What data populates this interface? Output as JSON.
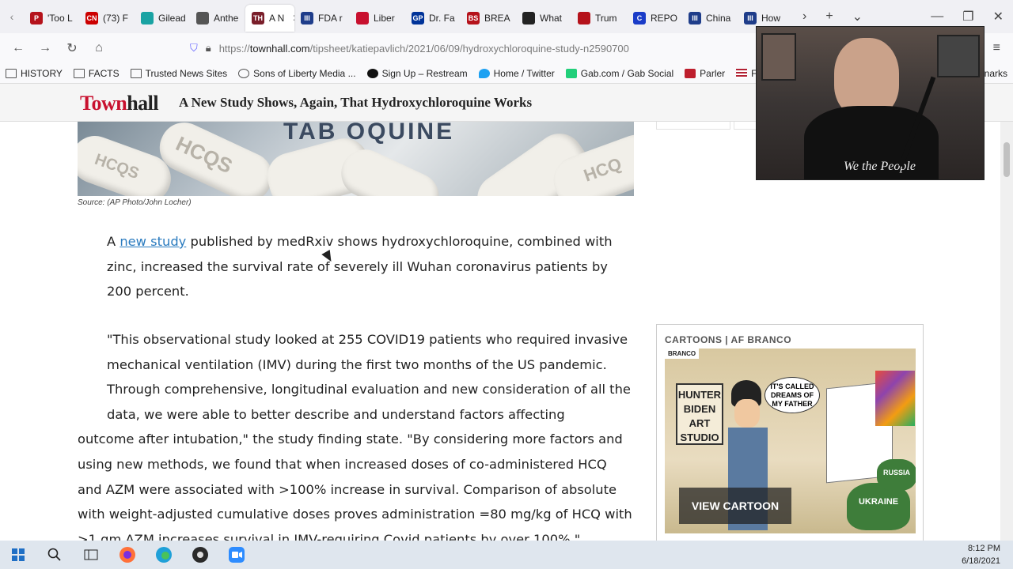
{
  "tabs": [
    {
      "label": "'Too L",
      "color": "#b5121b",
      "glyph": "P"
    },
    {
      "label": "(73) F",
      "color": "#cc0000",
      "glyph": "CN"
    },
    {
      "label": "Gilead",
      "color": "#1aa3a3",
      "glyph": ""
    },
    {
      "label": "Anthe",
      "color": "#555555",
      "glyph": ""
    },
    {
      "label": "A N",
      "color": "#7a1f2b",
      "glyph": "TH",
      "active": true
    },
    {
      "label": "FDA r",
      "color": "#1f3d8a",
      "glyph": "III"
    },
    {
      "label": "Liber",
      "color": "#c8102e",
      "glyph": ""
    },
    {
      "label": "Dr. Fa",
      "color": "#003399",
      "glyph": "GP"
    },
    {
      "label": "BREA",
      "color": "#b5121b",
      "glyph": "BS"
    },
    {
      "label": "What",
      "color": "#222222",
      "glyph": ""
    },
    {
      "label": "Trum",
      "color": "#b5121b",
      "glyph": ""
    },
    {
      "label": "REPO",
      "color": "#1a3cc8",
      "glyph": "C"
    },
    {
      "label": "China",
      "color": "#1f3d8a",
      "glyph": "III"
    },
    {
      "label": "How",
      "color": "#1f3d8a",
      "glyph": "III"
    }
  ],
  "address": {
    "prefix": "https://",
    "host": "townhall.com",
    "path": "/tipsheet/katiepavlich/2021/06/09/hydroxychloroquine-study-n2590700"
  },
  "bookmarks": [
    {
      "label": "HISTORY",
      "icon": "folder-icon"
    },
    {
      "label": "FACTS",
      "icon": "folder-icon"
    },
    {
      "label": "Trusted News Sites",
      "icon": "folder-icon"
    },
    {
      "label": "Sons of Liberty Media ...",
      "icon": "globe-icon"
    },
    {
      "label": "Sign Up – Restream",
      "icon": "restream-icon"
    },
    {
      "label": "Home / Twitter",
      "icon": "twitter-icon"
    },
    {
      "label": "Gab.com / Gab Social",
      "icon": "gab-icon"
    },
    {
      "label": "Parler",
      "icon": "parler-icon"
    },
    {
      "label": "From the Desk of D",
      "icon": "flag-icon"
    },
    {
      "label": "narks",
      "icon": ""
    }
  ],
  "site": {
    "logo_red": "Town",
    "logo_dark": "hall",
    "headline": "A New Study Shows, Again, That Hydroxychloroquine Works"
  },
  "article": {
    "photo_text": "TAB OQUINE",
    "pill_texts": [
      "HCQS",
      "HCQS",
      "HCQ"
    ],
    "credit": "Source: (AP Photo/John Locher)",
    "p1_start": "A ",
    "p1_link": "new study",
    "p1_rest": " published by medRxiv shows hydroxychloroquine, combined with zinc, increased the survival rate of severely ill Wuhan coronavirus patients by 200 percent.",
    "p2_indented": "\"This observational study looked at 255 COVID19 patients who required invasive mechanical ventilation (IMV) during the first two months of the US pandemic. Through comprehensive, longitudinal evaluation and new consideration of all the data, we were able to better describe and understand factors affecting",
    "p2_rest": "outcome after intubation,\" the study finding state. \"By considering more factors and using new methods, we found that when increased doses of co-administered HCQ and AZM were associated with >100% increase in survival. Comparison of absolute with weight-adjusted cumulative doses proves administration =80 mg/kg of HCQ with >1 gm AZM increases survival in IMV-requiring Covid patients by over 100%.\""
  },
  "sidebar": {
    "cartoon_label": "CARTOONS | AF BRANCO",
    "cartoon_sign": "HUNTER BIDEN ART STUDIO",
    "cartoon_bubble": "IT'S CALLED DREAMS OF MY FATHER",
    "cartoon_bags": [
      "UKRAINE",
      "RUSSIA"
    ],
    "cartoon_corner": "BRANCO",
    "cartoon_button": "VIEW CARTOON"
  },
  "webcam": {
    "shirt_text": "We the People"
  },
  "taskbar": {
    "time": "8:12 PM",
    "date": "6/18/2021"
  }
}
